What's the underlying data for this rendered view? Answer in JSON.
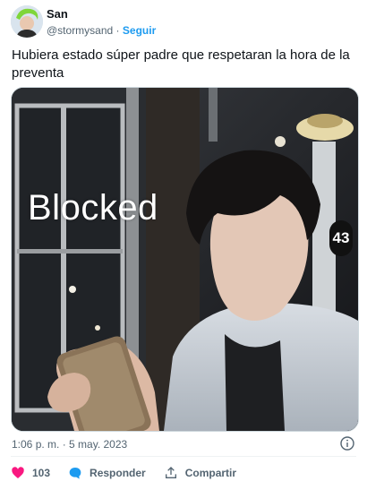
{
  "author": {
    "display_name": "San",
    "handle": "@stormysand",
    "separator": "·",
    "follow_label": "Seguir"
  },
  "tweet": {
    "text": "Hubiera estado súper padre que respetaran la hora de la preventa",
    "media": {
      "overlay_text": "Blocked",
      "sign_number": "43"
    },
    "timestamp": "1:06 p. m. · 5 may. 2023"
  },
  "actions": {
    "likes": "103",
    "reply_label": "Responder",
    "share_label": "Compartir"
  },
  "colors": {
    "like": "#f91880",
    "reply": "#1d9bf0",
    "link": "#1d9bf0",
    "muted": "#536471"
  }
}
